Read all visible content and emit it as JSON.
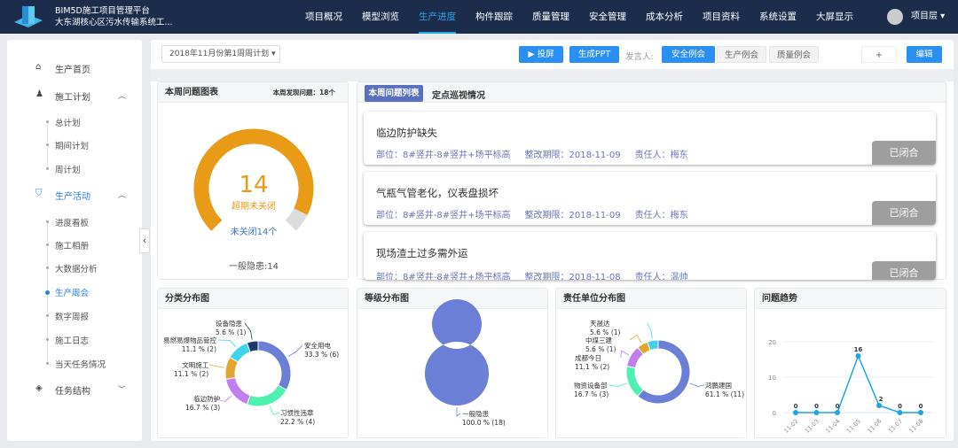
{
  "header": {
    "title": "BIM5D施工项目管理平台",
    "subtitle": "大东湖核心区污水传输系统工...",
    "nav": [
      "项目概况",
      "模型浏览",
      "生产进度",
      "构件跟踪",
      "质量管理",
      "安全管理",
      "成本分析",
      "项目资料",
      "系统设置",
      "大屏显示"
    ],
    "active_nav": "生产进度",
    "user": "项目层 ▾"
  },
  "sidebar": {
    "items": [
      {
        "label": "生产首页",
        "icon": "home-icon"
      },
      {
        "label": "施工计划",
        "icon": "team-icon",
        "sub": [
          "总计划",
          "期间计划",
          "周计划"
        ]
      },
      {
        "label": "生产活动",
        "icon": "shield-icon",
        "sub": [
          "进度看板",
          "施工相册",
          "大数据分析",
          "生产周会",
          "数字周报",
          "施工日志",
          "当天任务情况"
        ]
      },
      {
        "label": "任务结构",
        "icon": "cube-icon"
      }
    ],
    "active_sub": "生产周会"
  },
  "toolbar": {
    "week_select": "2018年11月份第1周周计划",
    "project_label": "▶ 投屏",
    "ppt_label": "生成PPT",
    "speaker_label": "发言人:",
    "meetings": [
      "安全例会",
      "生产例会",
      "质量例会"
    ],
    "active_meeting": "安全例会",
    "add_label": "+",
    "edit_label": "编辑"
  },
  "issue_chart": {
    "title": "本周问题图表",
    "count_label": "本周发现问题：18个",
    "gauge_value": "14",
    "gauge_label": "超期未关闭",
    "unclosed": "未关闭14个",
    "general": "一般隐患:14",
    "gauge_fraction": 0.93,
    "color": "#e99a16"
  },
  "issue_list": {
    "tabs": [
      "本周问题列表",
      "定点巡视情况"
    ],
    "items": [
      {
        "title": "临边防护缺失",
        "location": "部位：8#竖井-8#竖井+场平标高",
        "deadline": "整改期限：2018-11-09",
        "owner": "责任人：梅东",
        "status": "已闭合"
      },
      {
        "title": "气瓶气管老化，仪表盘损坏",
        "location": "部位：8#竖井-8#竖井+场平标高",
        "deadline": "整改期限：2018-11-09",
        "owner": "责任人：梅东",
        "status": "已闭合"
      },
      {
        "title": "现场渣土过多需外运",
        "location": "部位：8#竖井-8#竖井+场平标高",
        "deadline": "整改期限：2018-11-08",
        "owner": "责任人：温帅",
        "status": "已闭合"
      }
    ]
  },
  "chart_data": [
    {
      "type": "pie",
      "title": "分类分布图",
      "categories": [
        "安全用电",
        "习惯性违章",
        "临边防护",
        "文明施工",
        "易燃易爆物品管控",
        "设备隐患"
      ],
      "values": [
        6,
        4,
        3,
        2,
        2,
        1
      ],
      "labels": [
        "33.3 % (6)",
        "22.2 % (4)",
        "16.7 % (3)",
        "11.1 % (2)",
        "11.1 % (2)",
        "5.6 % (1)"
      ],
      "colors": [
        "#6b7fd7",
        "#4ef0b0",
        "#c17ef0",
        "#e2a630",
        "#3fd4ea",
        "#1c3a6b"
      ]
    },
    {
      "type": "pie",
      "title": "等级分布图",
      "categories": [
        "一般隐患"
      ],
      "values": [
        18
      ],
      "labels": [
        "100.0 % (18)"
      ],
      "colors": [
        "#6b7fd7"
      ]
    },
    {
      "type": "pie",
      "title": "责任单位分布图",
      "categories": [
        "鸿鹏建国",
        "物资设备部",
        "成都今日",
        "中煤三建",
        "天晟达"
      ],
      "values": [
        11,
        3,
        2,
        1,
        1
      ],
      "labels": [
        "61.1 % (11)",
        "16.7 % (3)",
        "11.1 % (2)",
        "5.6 % (1)",
        "5.6 % (1)"
      ],
      "colors": [
        "#6b7fd7",
        "#4ef0b0",
        "#c17ef0",
        "#e2a630",
        "#3fd4ea"
      ]
    },
    {
      "type": "line",
      "title": "问题趋势",
      "x": [
        "11-02",
        "11-03",
        "11-04",
        "11-05",
        "11-06",
        "11-07",
        "11-08"
      ],
      "values": [
        0,
        0,
        0,
        16,
        2,
        0,
        0
      ],
      "ylim": [
        0,
        20
      ],
      "yticks": [
        0,
        10,
        20
      ],
      "grid": true,
      "color": "#1aa7e0"
    }
  ]
}
